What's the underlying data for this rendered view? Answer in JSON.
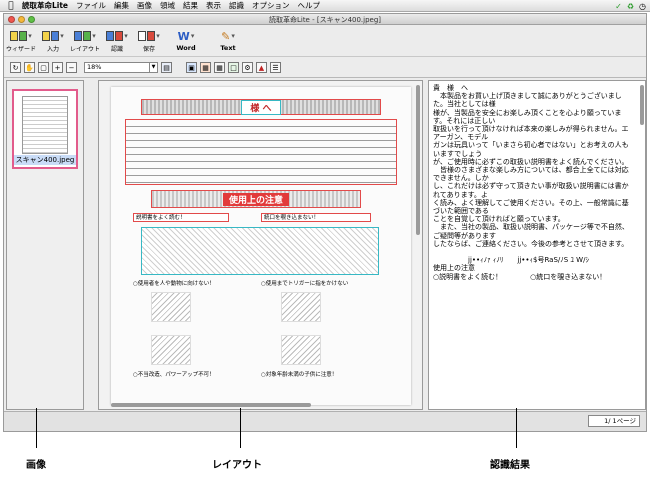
{
  "menubar": {
    "app_name": "読取革命Lite",
    "items": [
      "ファイル",
      "編集",
      "画像",
      "領域",
      "結果",
      "表示",
      "認識",
      "オプション",
      "ヘルプ"
    ]
  },
  "window": {
    "title": "読取革命Lite - [スキャン400.jpeg]"
  },
  "toolbar": {
    "wizard": "ウィザード",
    "input": "入力",
    "layout": "レイアウト",
    "recognize": "認識",
    "save": "保存",
    "word": "Word",
    "text": "Text"
  },
  "toolbar2": {
    "zoom_value": "18%"
  },
  "image_pane": {
    "thumbnail_caption": "スキャン400.jpeg"
  },
  "layout_pane": {
    "title": "様 へ",
    "section": "使用上の注意",
    "warn_left": "説明書をよく読む！",
    "warn_right": "統口を覗き込まない！",
    "caption1": "○使用者を人や動物に向けない！",
    "caption2": "○使用までトリガーに指をかけない",
    "caption3": "○不当改造、パワーアップ不可！",
    "caption4": "○対象年齢未満の子供に注意！"
  },
  "text_pane": {
    "ocr_text": "貴　様　へ\n　本製品をお買い上げ頂きまして誠にありがとうございました。当社としては様\n様が、当製品を安全にお楽しみ頂くことを心より願っています。それには正しい\n取扱いを行って頂けなければ本来の楽しみが得られません。エアーガン、モデル\nガンは玩具いって「いまさら初心者ではない」とお考えの人もいますでしょう\nが、ご使用時に必ずこの取扱い説明書をよく読んでください。\n　皆様のさまざまな楽しみ方については、都合上全てには対応できません。しか\nし、これだけは必ず守って頂きたい事が取扱い説明書には書かれてあります。よ\nく読み、よく理解してご使用ください。その上、一般常識に基づいた範囲である\nことを自覚して頂ければと願っています。\n　また、当社の製品、取扱い説明書、パッケージ等で不自然、ご疑問等があります\nしたならば、ご連絡ください。今後の参考とさせて頂きます。\n\n　　　　　jj••ｨﾉｧ ｨﾉﾘ　　jj••ｨ$号RaS/ﾉS ﾕ W/ｼ\n使用上の注意\n○説明書をよく読む！　　　　○統口を覗き込まない！"
  },
  "status": {
    "page": "1/ 1ページ"
  },
  "callouts": {
    "image": "画像",
    "layout": "レイアウト",
    "result": "認識結果"
  }
}
